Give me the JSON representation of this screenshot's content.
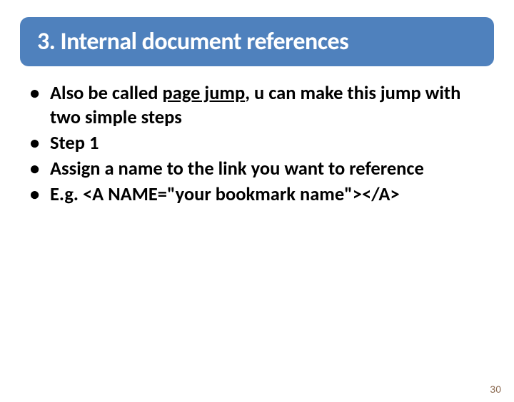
{
  "title": "3. Internal document references",
  "bullets": {
    "b1_prefix": "Also be called ",
    "b1_underlined": "page jump",
    "b1_suffix": ", u can make this jump with two simple steps",
    "b2": "Step 1",
    "b3": "Assign a name to the link you want to reference",
    "b4": "E.g. <A NAME=\"your bookmark name\"></A>"
  },
  "page_number": "30"
}
